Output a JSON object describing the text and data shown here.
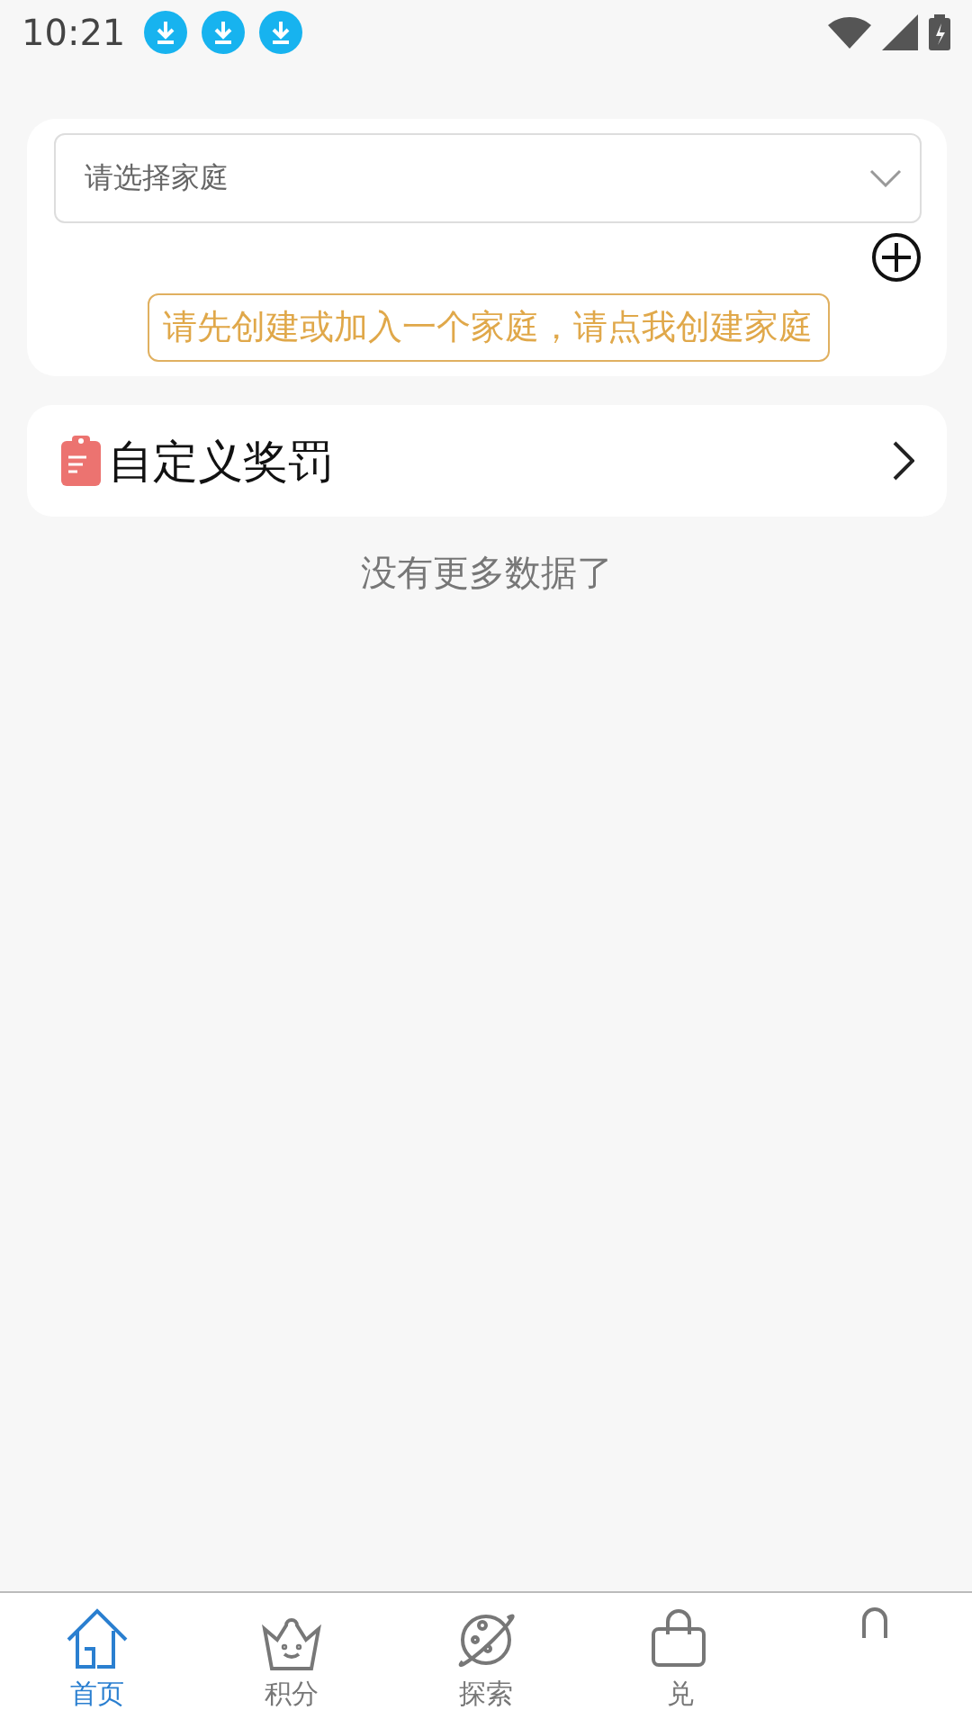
{
  "status_bar": {
    "time": "10:21",
    "notifications": [
      {
        "kind": "download"
      },
      {
        "kind": "download"
      },
      {
        "kind": "download"
      }
    ]
  },
  "family": {
    "select": {
      "placeholder": "请选择家庭"
    },
    "create_hint": "请先创建或加入一个家庭，请点我创建家庭"
  },
  "menu": [
    {
      "label": "自定义奖罚"
    }
  ],
  "list_end": "没有更多数据了",
  "tabs": [
    {
      "kind": "home",
      "label": "首页",
      "selected": true
    },
    {
      "kind": "points",
      "label": "积分",
      "selected": false
    },
    {
      "kind": "explore",
      "label": "探索",
      "selected": false
    },
    {
      "kind": "shop",
      "label": "兑",
      "selected": false
    },
    {
      "kind": "profile",
      "selected": false
    }
  ]
}
